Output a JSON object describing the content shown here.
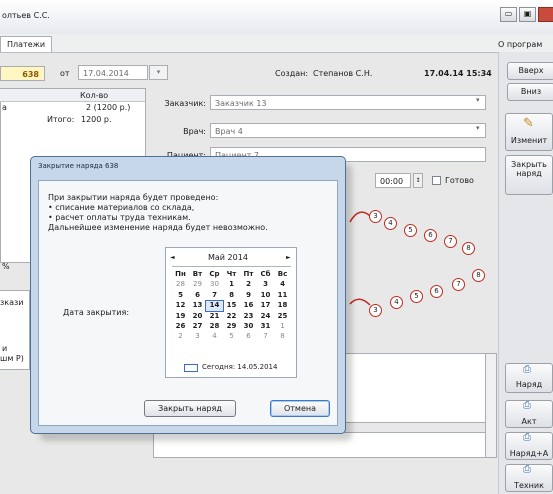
{
  "window": {
    "title": "олтьев С.С.",
    "min": "▭",
    "max": "▣"
  },
  "tabs": {
    "payments": "Платежи",
    "about": "О програм"
  },
  "header": {
    "number": "638",
    "from_label": "от",
    "date": "17.04.2014",
    "created_label": "Создан:",
    "created_by": "Степанов С.Н.",
    "created_at": "17.04.14 15:34"
  },
  "left_panel": {
    "qty_header": "Кол-во",
    "row_label": "а",
    "row_qty": "2 (1200 р.)",
    "total_label": "Итого:",
    "total_value": "1200 р.",
    "pct": "%",
    "stub_label": "зкази",
    "stub_a": "и",
    "stub_b": "шм Р)"
  },
  "form": {
    "customer_label": "Заказчик:",
    "customer_value": "Заказчик 13",
    "doctor_label": "Врач:",
    "doctor_value": "Врач 4",
    "patient_label": "Пациент:",
    "patient_value": "Пациент 7",
    "time": "00:00",
    "ready_label": "Готово"
  },
  "teeth": {
    "upper": [
      "3",
      "4",
      "5",
      "6",
      "7",
      "8"
    ],
    "lower": [
      "3",
      "4",
      "5",
      "6",
      "7",
      "8"
    ]
  },
  "right_panel": {
    "up": "Вверх",
    "down": "Вниз",
    "edit": "Изменит",
    "close_order": "Закрыть наряд",
    "order": "Наряд",
    "act": "Акт",
    "order_act": "Наряд+А",
    "tech": "Техник"
  },
  "dialog": {
    "title": "Закрытие наряда 638",
    "lines": [
      "При закрытии наряда будет проведено:",
      "• списание материалов со склада,",
      "• расчет оплаты труда техникам.",
      "Дальнейшее изменение наряда будет невозможно."
    ],
    "date_label": "Дата закрытия:",
    "close_button": "Закрыть наряд",
    "cancel_button": "Отмена",
    "calendar": {
      "month": "Май 2014",
      "prev": "◄",
      "next": "►",
      "weekdays": [
        "Пн",
        "Вт",
        "Ср",
        "Чт",
        "Пт",
        "Сб",
        "Вс"
      ],
      "weeks": [
        [
          "28",
          "29",
          "30",
          "1",
          "2",
          "3",
          "4"
        ],
        [
          "5",
          "6",
          "7",
          "8",
          "9",
          "10",
          "11"
        ],
        [
          "12",
          "13",
          "14",
          "15",
          "16",
          "17",
          "18"
        ],
        [
          "19",
          "20",
          "21",
          "22",
          "23",
          "24",
          "25"
        ],
        [
          "26",
          "27",
          "28",
          "29",
          "30",
          "31",
          "1"
        ],
        [
          "2",
          "3",
          "4",
          "5",
          "6",
          "7",
          "8"
        ]
      ],
      "selected": "14",
      "today": "Сегодня: 14.05.2014"
    }
  }
}
